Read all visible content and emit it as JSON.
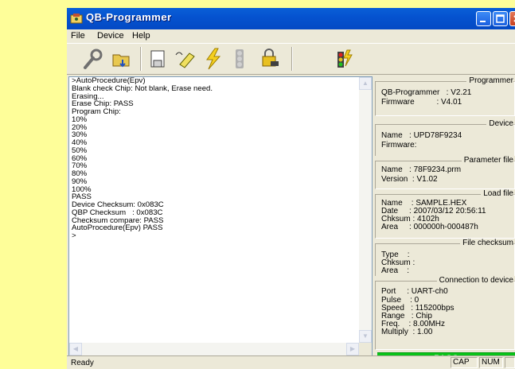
{
  "window": {
    "title": "QB-Programmer"
  },
  "menu": [
    "File",
    "Device",
    "Help"
  ],
  "toolbar": [
    "settings-wrench-icon",
    "open-folder-icon",
    "blank-check-icon",
    "erase-icon",
    "program-lightning-icon",
    "verify-traffic-light-icon",
    "security-lock-icon",
    "autoprocedure-icon"
  ],
  "log": {
    "lines": [
      ">AutoProcedure(Epv)",
      "Blank check Chip: Not blank, Erase need.",
      "Erasing...",
      "Erase Chip: PASS",
      "Program Chip:",
      "10%",
      "20%",
      "30%",
      "40%",
      "50%",
      "60%",
      "70%",
      "80%",
      "90%",
      "100%",
      "PASS",
      "Device Checksum: 0x083C",
      "QBP Checksum   : 0x083C",
      "Checksum compare: PASS",
      "AutoProcedure(Epv) PASS",
      ">"
    ]
  },
  "panel": {
    "programmer": {
      "title": "Programmer",
      "rows": [
        "QB-Programmer   : V2.21",
        "Firmware          : V4.01"
      ]
    },
    "device": {
      "title": "Device",
      "rows": [
        "Name   : UPD78F9234",
        "Firmware:"
      ]
    },
    "param": {
      "title": "Parameter file",
      "rows": [
        "Name   : 78F9234.prm",
        "Version  : V1.02"
      ]
    },
    "load": {
      "title": "Load file",
      "rows": [
        "Name    : SAMPLE.HEX",
        "Date     : 2007/03/12 20:56:11",
        "Chksum : 4102h",
        "Area     : 000000h-000487h"
      ]
    },
    "checksum": {
      "title": "File checksum",
      "rows": [
        "Type    :",
        "Chksum :",
        "Area    :"
      ]
    },
    "conn": {
      "title": "Connection to device",
      "rows": [
        "Port     : UART-ch0",
        "Pulse    : 0",
        "Speed   : 115200bps",
        "Range   : Chip",
        "Freq.    : 8.00MHz",
        "Multiply  : 1.00"
      ]
    }
  },
  "result": "PASS",
  "status": {
    "text": "Ready",
    "cap": "CAP",
    "num": "NUM",
    "scrl": ""
  }
}
